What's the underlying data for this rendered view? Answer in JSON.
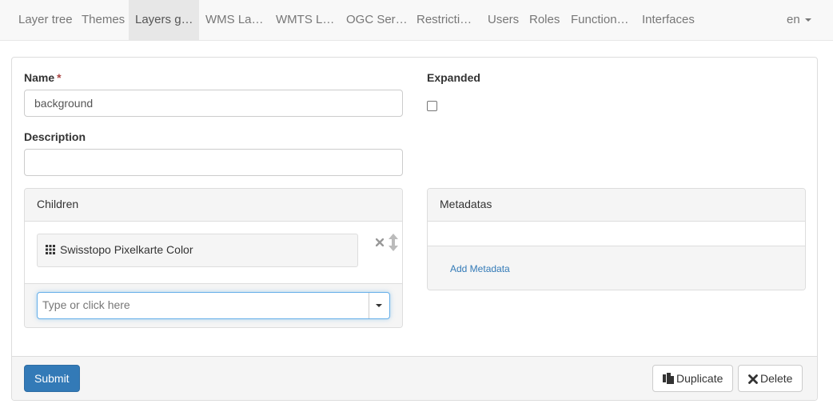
{
  "nav": {
    "tabs": [
      {
        "label": "Layer tree"
      },
      {
        "label": "Themes"
      },
      {
        "label": "Layers g…"
      },
      {
        "label": "WMS La…"
      },
      {
        "label": "WMTS L…"
      },
      {
        "label": "OGC Ser…"
      },
      {
        "label": "Restricti…"
      },
      {
        "label": "Users"
      },
      {
        "label": "Roles"
      },
      {
        "label": "Function…"
      },
      {
        "label": "Interfaces"
      }
    ],
    "active_tab": "Layers g…",
    "language": "en"
  },
  "form": {
    "name_label": "Name",
    "name_required_mark": "*",
    "name_value": "background",
    "expanded_label": "Expanded",
    "expanded_checked": false,
    "description_label": "Description",
    "description_value": "",
    "children": {
      "heading": "Children",
      "items": [
        {
          "label": "Swisstopo Pixelkarte Color",
          "icon": "grid-icon"
        }
      ],
      "select_placeholder": "Type or click here"
    },
    "metadatas": {
      "heading": "Metadatas",
      "add_link": "Add Metadata"
    }
  },
  "footer": {
    "submit_label": "Submit",
    "duplicate_label": "Duplicate",
    "delete_label": "Delete"
  },
  "colors": {
    "primary": "#337ab7",
    "link": "#337ab7",
    "required": "#a94442",
    "navbar_bg": "#f8f8f8",
    "active_tab_bg": "#e7e7e7"
  }
}
